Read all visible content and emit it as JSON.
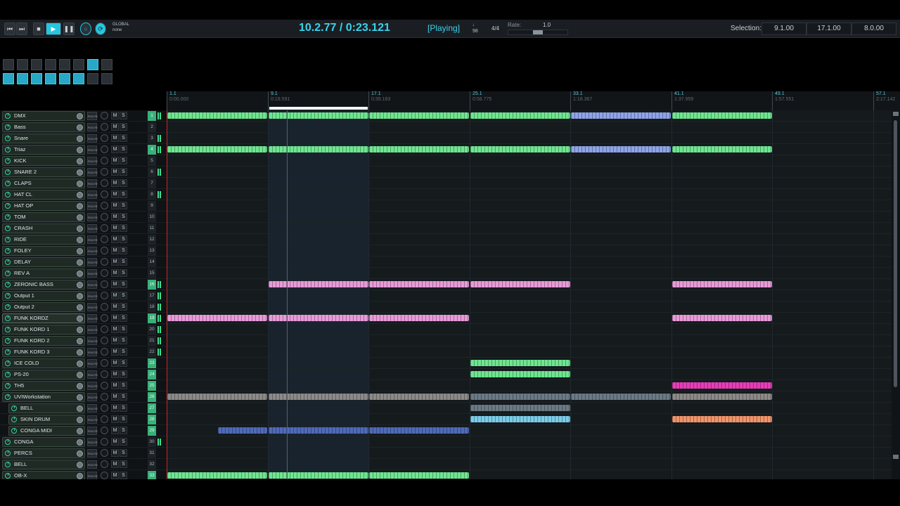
{
  "transport": {
    "global_label": "GLOBAL",
    "global_value": "none",
    "timecode": "10.2.77 / 0:23.121",
    "status": "[Playing]",
    "tempo": "98",
    "meter": "4/4",
    "rate_label": "Rate:",
    "rate_value": "1.0",
    "selection_label": "Selection:",
    "sel_start": "9.1.00",
    "sel_end": "17.1.00",
    "sel_len": "8.0.00",
    "accent_color": "#27c6e0"
  },
  "ruler": {
    "markers": [
      {
        "bar": "1.1",
        "time": "0:00.000"
      },
      {
        "bar": "9.1",
        "time": "0:19.591"
      },
      {
        "bar": "17.1",
        "time": "0:39.183"
      },
      {
        "bar": "25.1",
        "time": "0:58.775"
      },
      {
        "bar": "33.1",
        "time": "1:18.367"
      },
      {
        "bar": "41.1",
        "time": "1:37.959"
      },
      {
        "bar": "49.1",
        "time": "1:57.551"
      },
      {
        "bar": "57.1",
        "time": "2:17.142"
      }
    ]
  },
  "mixer_labels": {
    "route": "ROUTE",
    "mute": "M",
    "solo": "S"
  },
  "tracks": [
    {
      "name": "DMX",
      "num": "1"
    },
    {
      "name": "Bass",
      "num": "2"
    },
    {
      "name": "Snare",
      "num": "3"
    },
    {
      "name": "Triaz",
      "num": "4"
    },
    {
      "name": "KICK",
      "num": "5"
    },
    {
      "name": "SNARE 2",
      "num": "6"
    },
    {
      "name": "CLAPS",
      "num": "7"
    },
    {
      "name": "HAT CL",
      "num": "8"
    },
    {
      "name": "HAT OP",
      "num": "9"
    },
    {
      "name": "TOM",
      "num": "10"
    },
    {
      "name": "CRASH",
      "num": "11"
    },
    {
      "name": "RIDE",
      "num": "12"
    },
    {
      "name": "FOLEY",
      "num": "13"
    },
    {
      "name": "DELAY",
      "num": "14"
    },
    {
      "name": "REV A",
      "num": "15"
    },
    {
      "name": "ZERONIC BASS",
      "num": "16"
    },
    {
      "name": "Output 1",
      "num": "17"
    },
    {
      "name": "Output 2",
      "num": "18"
    },
    {
      "name": "FUNK KORDZ",
      "num": "19"
    },
    {
      "name": "FUNK KORD 1",
      "num": "20"
    },
    {
      "name": "FUNK KORD 2",
      "num": "21"
    },
    {
      "name": "FUNK KORD 3",
      "num": "22"
    },
    {
      "name": "ICE COLD",
      "num": "23"
    },
    {
      "name": "PS-20",
      "num": "24"
    },
    {
      "name": "TH5",
      "num": "25"
    },
    {
      "name": "UVIWorkstation",
      "num": "26"
    },
    {
      "name": "BELL",
      "num": "27"
    },
    {
      "name": "SKIN DRUM",
      "num": "28"
    },
    {
      "name": "CONGA MIDI",
      "num": "29"
    },
    {
      "name": "CONGA",
      "num": "30"
    },
    {
      "name": "PERCS",
      "num": "31"
    },
    {
      "name": "BELL",
      "num": "32"
    },
    {
      "name": "OB-X",
      "num": "33"
    }
  ]
}
